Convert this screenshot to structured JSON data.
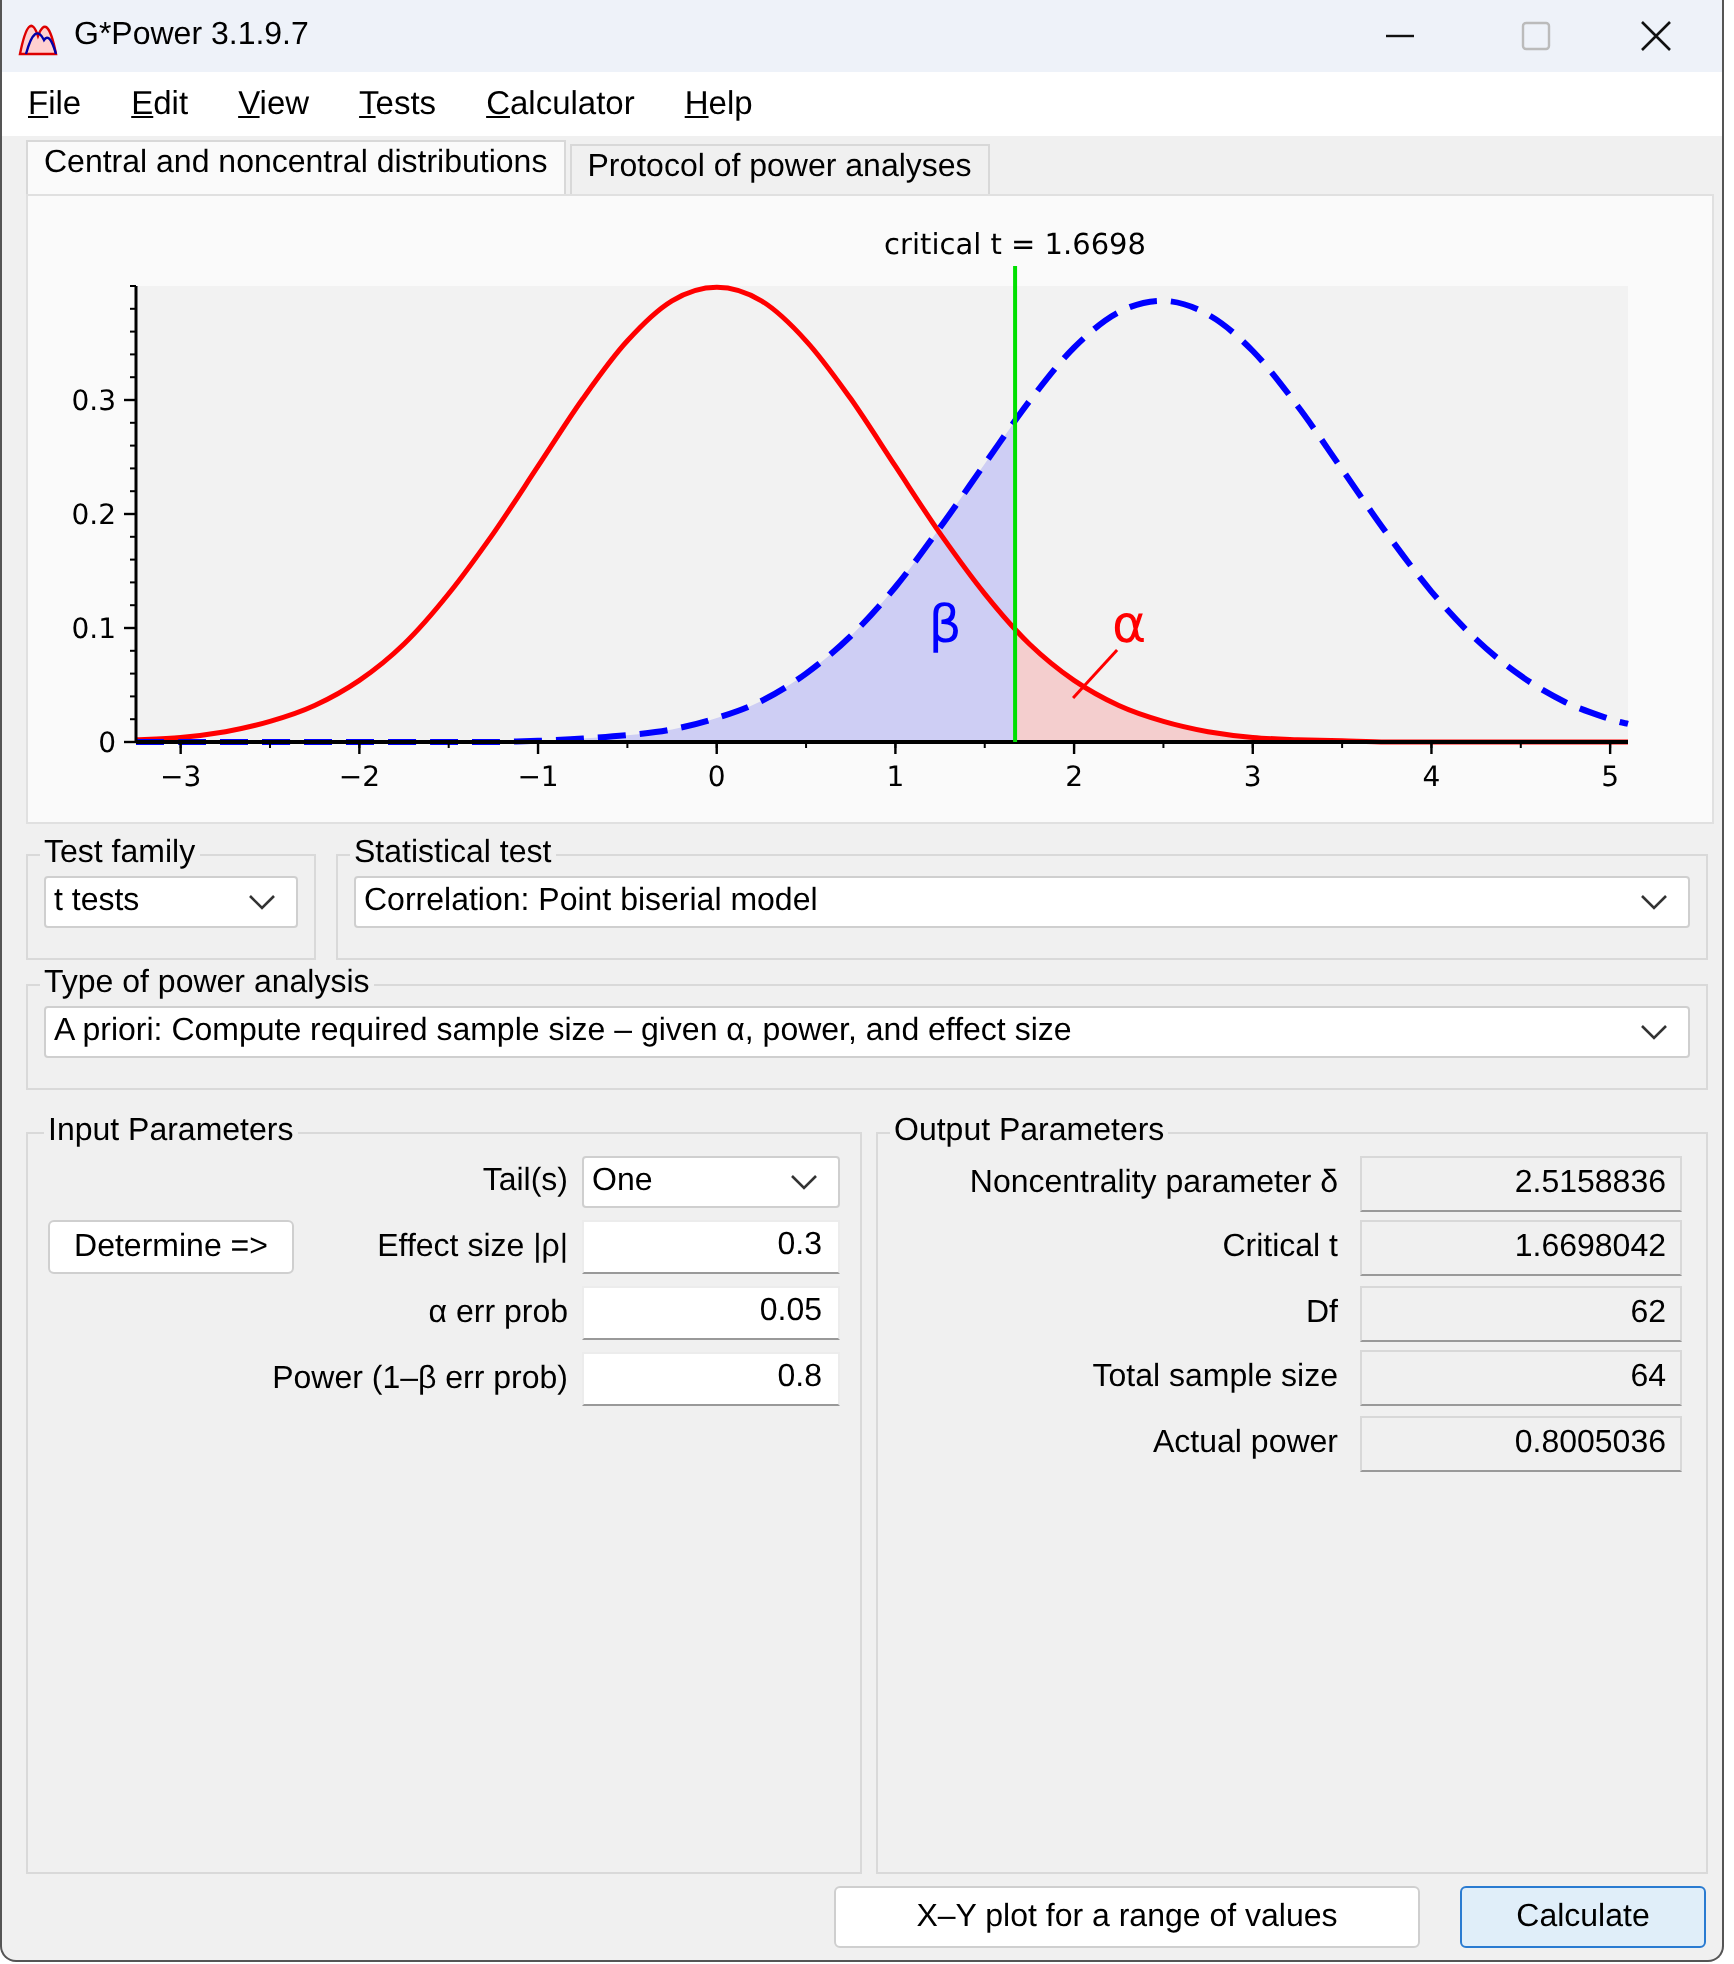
{
  "window": {
    "title": "G*Power 3.1.9.7"
  },
  "menu": [
    {
      "label": "File"
    },
    {
      "label": "Edit"
    },
    {
      "label": "View"
    },
    {
      "label": "Tests"
    },
    {
      "label": "Calculator"
    },
    {
      "label": "Help"
    }
  ],
  "tabs": [
    {
      "label": "Central and noncentral distributions",
      "selected": true
    },
    {
      "label": "Protocol of power analyses",
      "selected": false
    }
  ],
  "chart_data": {
    "type": "line",
    "x": [
      -3.25,
      -3,
      -2.75,
      -2.5,
      -2.25,
      -2,
      -1.75,
      -1.5,
      -1.25,
      -1,
      -0.75,
      -0.5,
      -0.25,
      0,
      0.25,
      0.5,
      0.75,
      1,
      1.25,
      1.5,
      1.75,
      2,
      2.25,
      2.5,
      2.75,
      3,
      3.25,
      3.5,
      3.75,
      4,
      4.25,
      4.5,
      4.75,
      5,
      5.1
    ],
    "series": [
      {
        "color": "#ff0000",
        "line_style": "solid",
        "values": [
          0.002,
          0.004,
          0.009,
          0.018,
          0.032,
          0.054,
          0.086,
          0.13,
          0.183,
          0.242,
          0.301,
          0.352,
          0.387,
          0.399,
          0.387,
          0.352,
          0.301,
          0.242,
          0.183,
          0.13,
          0.086,
          0.054,
          0.032,
          0.018,
          0.009,
          0.004,
          0.002,
          0.001,
          0,
          0,
          0,
          0,
          0,
          0,
          0
        ]
      },
      {
        "color": "#0000ff",
        "line_style": "dashed",
        "values": [
          0,
          0,
          0,
          0,
          0,
          0,
          0,
          0,
          0,
          0.001,
          0.003,
          0.006,
          0.011,
          0.021,
          0.036,
          0.06,
          0.093,
          0.136,
          0.188,
          0.244,
          0.299,
          0.346,
          0.377,
          0.387,
          0.375,
          0.343,
          0.295,
          0.239,
          0.183,
          0.132,
          0.09,
          0.058,
          0.035,
          0.02,
          0.016
        ]
      }
    ],
    "xlim": [
      -3.25,
      5.1
    ],
    "ylim": [
      0,
      0.4
    ],
    "xticks": [
      -3,
      -2,
      -1,
      0,
      1,
      2,
      3,
      4,
      5
    ],
    "yticks": [
      0,
      0.1,
      0.2,
      0.3
    ],
    "ref_lines": [
      {
        "axis": "x",
        "value": 1.6698,
        "label": "critical t = 1.6698",
        "color": "#00e000"
      }
    ],
    "annotations": [
      "β",
      "α"
    ]
  },
  "test_family": {
    "label": "Test family",
    "value": "t tests"
  },
  "statistical_test": {
    "label": "Statistical test",
    "value": "Correlation: Point biserial model"
  },
  "analysis_type": {
    "label": "Type of power analysis",
    "value": "A priori: Compute required sample size – given α, power, and effect size"
  },
  "input_parameters": {
    "title": "Input Parameters",
    "rows": [
      {
        "kind": "dropdown",
        "label": "Tail(s)",
        "value": "One"
      },
      {
        "kind": "field",
        "label": "Effect size |ρ|",
        "value": "0.3",
        "button": "Determine =>"
      },
      {
        "kind": "field",
        "label": "α err prob",
        "value": "0.05"
      },
      {
        "kind": "field",
        "label": "Power (1–β err prob)",
        "value": "0.8"
      }
    ]
  },
  "output_parameters": {
    "title": "Output Parameters",
    "rows": [
      {
        "label": "Noncentrality parameter δ",
        "value": "2.5158836"
      },
      {
        "label": "Critical t",
        "value": "1.6698042"
      },
      {
        "label": "Df",
        "value": "62"
      },
      {
        "label": "Total sample size",
        "value": "64"
      },
      {
        "label": "Actual power",
        "value": "0.8005036"
      }
    ]
  },
  "buttons": [
    {
      "label": "X–Y plot for a range of values",
      "default": false
    },
    {
      "label": "Calculate",
      "default": true
    }
  ]
}
